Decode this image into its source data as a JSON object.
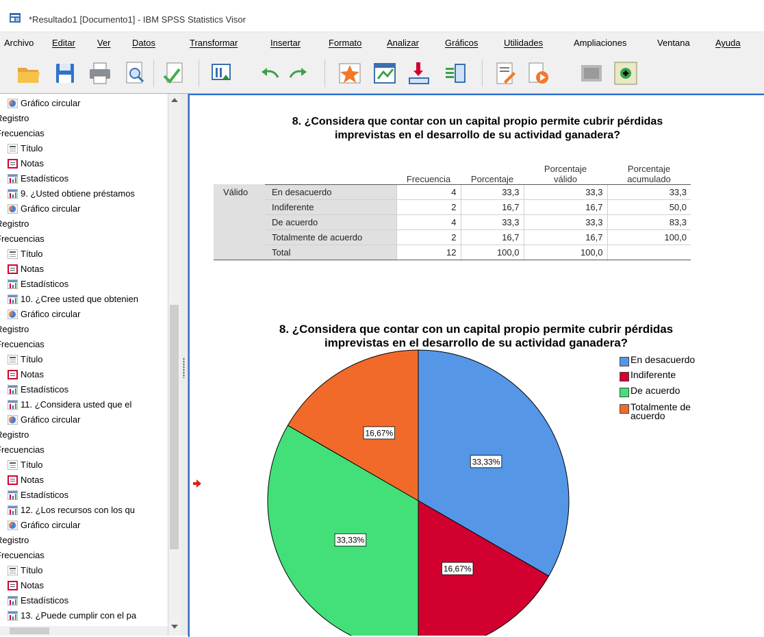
{
  "window": {
    "title": "*Resultado1 [Documento1] - IBM SPSS Statistics Visor"
  },
  "menu": [
    "Archivo",
    "Editar",
    "Ver",
    "Datos",
    "Transformar",
    "Insertar",
    "Formato",
    "Analizar",
    "Gráficos",
    "Utilidades",
    "Ampliaciones",
    "Ventana",
    "Ayuda"
  ],
  "toolbar": {
    "icons": [
      "open-folder-icon",
      "save-icon",
      "print-icon",
      "print-preview-icon",
      "export-icon",
      "goto-data-icon",
      "undo-icon",
      "redo-icon",
      "goto-case-icon",
      "goto-variable-icon",
      "insert-cases-icon",
      "insert-variable-icon",
      "create-report-icon",
      "run-script-icon",
      "disabled-icon",
      "expand-icon"
    ]
  },
  "outline": {
    "items": [
      {
        "icon": "pie-chart-icon",
        "label": "Gráfico circular"
      },
      {
        "icon": "",
        "label": "Registro"
      },
      {
        "icon": "",
        "label": "Frecuencias"
      },
      {
        "icon": "title-icon",
        "label": "Título"
      },
      {
        "icon": "notes-icon",
        "label": "Notas"
      },
      {
        "icon": "table-icon",
        "label": "Estadísticos"
      },
      {
        "icon": "table-icon",
        "label": "9. ¿Usted obtiene préstamos"
      },
      {
        "icon": "pie-chart-icon",
        "label": "Gráfico circular"
      },
      {
        "icon": "",
        "label": "Registro"
      },
      {
        "icon": "",
        "label": "Frecuencias"
      },
      {
        "icon": "title-icon",
        "label": "Título"
      },
      {
        "icon": "notes-icon",
        "label": "Notas"
      },
      {
        "icon": "table-icon",
        "label": "Estadísticos"
      },
      {
        "icon": "table-icon",
        "label": "10. ¿Cree usted que obtenien"
      },
      {
        "icon": "pie-chart-icon",
        "label": "Gráfico circular"
      },
      {
        "icon": "",
        "label": "Registro"
      },
      {
        "icon": "",
        "label": "Frecuencias"
      },
      {
        "icon": "title-icon",
        "label": "Título"
      },
      {
        "icon": "notes-icon",
        "label": "Notas"
      },
      {
        "icon": "table-icon",
        "label": "Estadísticos"
      },
      {
        "icon": "table-icon",
        "label": "11. ¿Considera usted que el"
      },
      {
        "icon": "pie-chart-icon",
        "label": "Gráfico circular"
      },
      {
        "icon": "",
        "label": "Registro"
      },
      {
        "icon": "",
        "label": "Frecuencias"
      },
      {
        "icon": "title-icon",
        "label": "Título"
      },
      {
        "icon": "notes-icon",
        "label": "Notas"
      },
      {
        "icon": "table-icon",
        "label": "Estadísticos"
      },
      {
        "icon": "table-icon",
        "label": "12. ¿Los recursos con los qu"
      },
      {
        "icon": "pie-chart-icon",
        "label": "Gráfico circular"
      },
      {
        "icon": "",
        "label": "Registro"
      },
      {
        "icon": "",
        "label": "Frecuencias"
      },
      {
        "icon": "title-icon",
        "label": "Título"
      },
      {
        "icon": "notes-icon",
        "label": "Notas"
      },
      {
        "icon": "table-icon",
        "label": "Estadísticos"
      },
      {
        "icon": "table-icon",
        "label": "13. ¿Puede cumplir con el pa"
      }
    ]
  },
  "table": {
    "title_line1": "8. ¿Considera que contar con un capital propio permite cubrir pérdidas",
    "title_line2": "imprevistas en el desarrollo de su actividad ganadera?",
    "headers": [
      "Frecuencia",
      "Porcentaje",
      "Porcentaje válido",
      "Porcentaje acumulado"
    ],
    "header_valid_l1": "Porcentaje",
    "header_valid_l2": "válido",
    "header_cum_l1": "Porcentaje",
    "header_cum_l2": "acumulado",
    "group_label": "Válido",
    "rows": [
      {
        "label": "En desacuerdo",
        "freq": "4",
        "pct": "33,3",
        "valid": "33,3",
        "cum": "33,3"
      },
      {
        "label": "Indiferente",
        "freq": "2",
        "pct": "16,7",
        "valid": "16,7",
        "cum": "50,0"
      },
      {
        "label": "De acuerdo",
        "freq": "4",
        "pct": "33,3",
        "valid": "33,3",
        "cum": "83,3"
      },
      {
        "label": "Totalmente de acuerdo",
        "freq": "2",
        "pct": "16,7",
        "valid": "16,7",
        "cum": "100,0"
      },
      {
        "label": "Total",
        "freq": "12",
        "pct": "100,0",
        "valid": "100,0",
        "cum": ""
      }
    ]
  },
  "chart_data": {
    "type": "pie",
    "title": "8. ¿Considera que contar con un capital propio permite cubrir pérdidas imprevistas en el desarrollo de su actividad ganadera?",
    "title_line1": "8. ¿Considera que contar con un capital propio permite cubrir pérdidas",
    "title_line2": "imprevistas en el desarrollo de su actividad ganadera?",
    "categories": [
      "En desacuerdo",
      "Indiferente",
      "De acuerdo",
      "Totalmente de acuerdo"
    ],
    "values": [
      33.33,
      16.67,
      33.33,
      16.67
    ],
    "labels": [
      "33,33%",
      "16,67%",
      "33,33%",
      "16,67%"
    ],
    "colors": [
      "#5596e6",
      "#d1002e",
      "#43e07a",
      "#f26a2a"
    ],
    "legend": {
      "position": "top-right",
      "entries": [
        "En desacuerdo",
        "Indiferente",
        "De acuerdo",
        "Totalmente de acuerdo"
      ],
      "entry4_line1": "Totalmente de",
      "entry4_line2": "acuerdo"
    }
  }
}
